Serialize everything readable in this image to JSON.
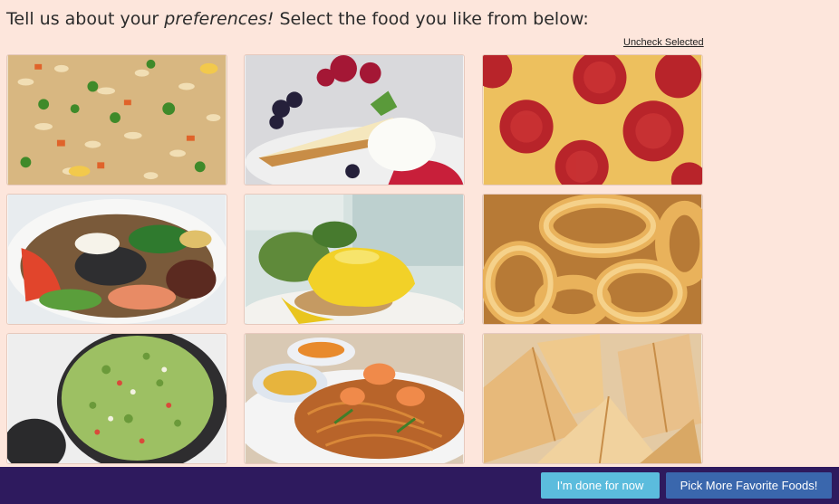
{
  "prompt": {
    "before": "Tell us about your ",
    "emphasis": "preferences!",
    "after": " Select the food you like from below:"
  },
  "uncheck_label": "Uncheck Selected",
  "foods": [
    {
      "icon": "fried-rice-image"
    },
    {
      "icon": "berry-cheesecake-image"
    },
    {
      "icon": "pepperoni-pizza-image"
    },
    {
      "icon": "bibimbap-image"
    },
    {
      "icon": "eggs-benedict-image"
    },
    {
      "icon": "onion-rings-image"
    },
    {
      "icon": "guacamole-image"
    },
    {
      "icon": "pad-thai-image"
    },
    {
      "icon": "samosas-image"
    }
  ],
  "footer": {
    "done_label": "I'm done for now",
    "more_label": "Pick More Favorite Foods!"
  },
  "colors": {
    "background": "#fde6dc",
    "footer": "#2e1a5e",
    "done_button": "#5bbcdd",
    "more_button": "#3a67ad"
  }
}
